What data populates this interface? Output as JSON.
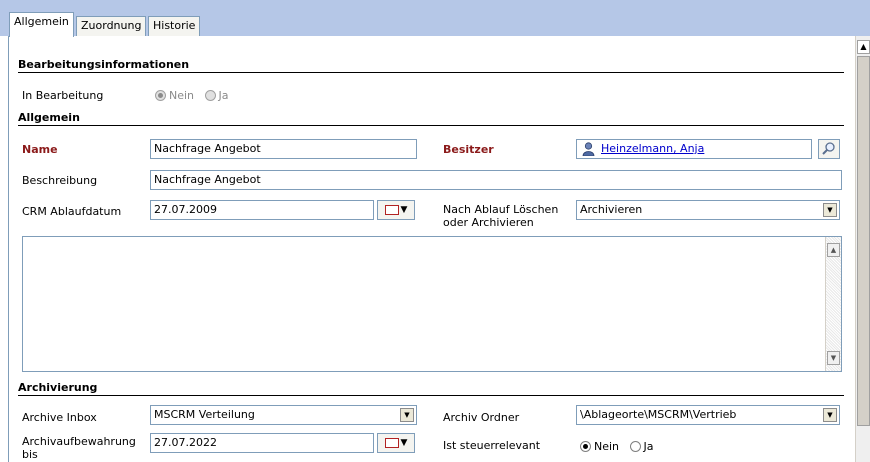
{
  "tabs": [
    {
      "label": "Allgemein",
      "active": true
    },
    {
      "label": "Zuordnung",
      "active": false
    },
    {
      "label": "Historie",
      "active": false
    }
  ],
  "sections": {
    "bearbeitung": "Bearbeitungsinformationen",
    "allgemein": "Allgemein",
    "archivierung": "Archivierung"
  },
  "in_bearbeitung": {
    "label": "In Bearbeitung",
    "options": [
      "Nein",
      "Ja"
    ],
    "selected": "Nein"
  },
  "name": {
    "label": "Name",
    "value": "Nachfrage Angebot"
  },
  "besitzer": {
    "label": "Besitzer",
    "value": "Heinzelmann, Anja"
  },
  "beschreibung": {
    "label": "Beschreibung",
    "value": "Nachfrage Angebot"
  },
  "crm_ablaufdatum": {
    "label": "CRM Ablaufdatum",
    "value": "27.07.2009"
  },
  "nach_ablauf": {
    "label_line1": "Nach Ablauf Löschen",
    "label_line2": "oder Archivieren",
    "value": "Archivieren"
  },
  "notes": {
    "value": ""
  },
  "archive_inbox": {
    "label": "Archive Inbox",
    "value": "MSCRM Verteilung"
  },
  "archiv_ordner": {
    "label": "Archiv Ordner",
    "value": "\\Ablageorte\\MSCRM\\Vertrieb"
  },
  "archivaufbewahrung": {
    "label_line1": "Archivaufbewahrung",
    "label_line2": "bis",
    "value": "27.07.2022"
  },
  "steuerrelevant": {
    "label": "Ist steuerrelevant",
    "options": [
      "Nein",
      "Ja"
    ],
    "selected": "Nein"
  },
  "colors": {
    "tabbar_bg": "#b5c7e7",
    "required_label": "#8b1a1a",
    "link": "#0000cc",
    "border": "#7f9db9"
  }
}
